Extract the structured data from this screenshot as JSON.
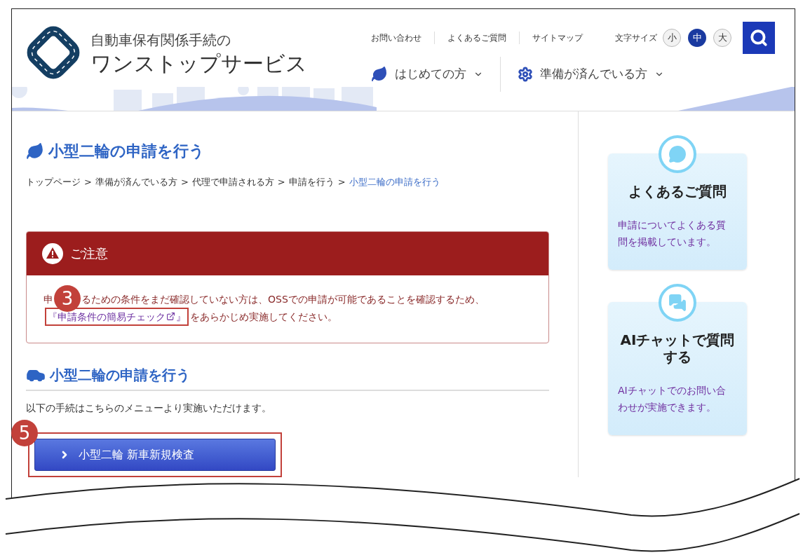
{
  "header": {
    "title_line_1": "自動車保有関係手続の",
    "title_line_2": "ワンストップサービス",
    "utility_links": [
      "お問い合わせ",
      "よくあるご質問",
      "サイトマップ"
    ],
    "font_size": {
      "label": "文字サイズ",
      "options": [
        {
          "label": "小",
          "selected": false
        },
        {
          "label": "中",
          "selected": true
        },
        {
          "label": "大",
          "selected": false
        }
      ]
    },
    "nav": [
      {
        "kind": "leaf",
        "label": "はじめての方"
      },
      {
        "kind": "gear",
        "label": "準備が済んでいる方"
      }
    ]
  },
  "page_title": "小型二輪の申請を行う",
  "breadcrumb": [
    {
      "label": "トップページ",
      "separator": ">",
      "current": false
    },
    {
      "label": "準備が済んでいる方",
      "separator": ">",
      "current": false
    },
    {
      "label": "代理で申請される方",
      "separator": ">",
      "current": false
    },
    {
      "label": "申請を行う",
      "separator": ">",
      "current": false
    },
    {
      "label": "小型二輪の申請を行う",
      "current": true
    }
  ],
  "notice": {
    "title": "ご注意",
    "text_start": "申",
    "marker": "3",
    "text_rest": "るための条件をまだ確認していない方は、OSSでの申請が可能であることを確認するため、",
    "link_open": "『申請条件の簡易チェック",
    "link_close": "』",
    "text_end": "をあらかじめ実施してください。"
  },
  "section": {
    "title": "小型二輪の申請を行う",
    "intro": "以下の手続はこちらのメニューより実施いただけます。",
    "marker": "5",
    "button": "小型二輪 新車新規検査"
  },
  "sidebar": [
    {
      "kind": "faq",
      "title": "よくあるご質問",
      "text": "申請についてよくある質問を掲載しています。"
    },
    {
      "kind": "chat",
      "title": "AIチャットで質問する",
      "text": "AIチャットでのお問い合わせが実施できます。"
    }
  ]
}
